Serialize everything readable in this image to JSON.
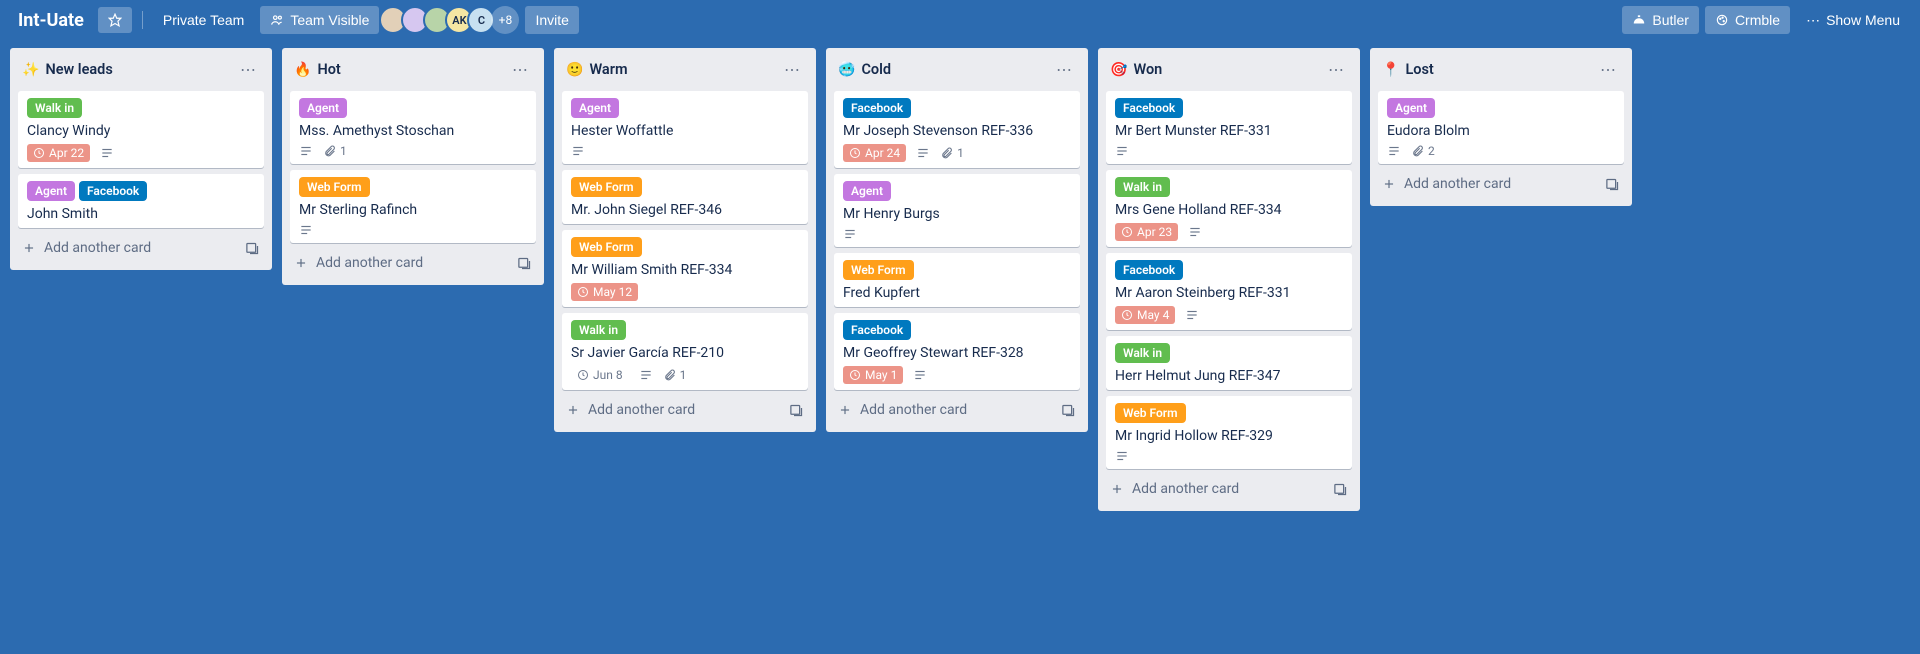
{
  "header": {
    "board_title": "Int-Uate",
    "private_team": "Private Team",
    "team_visible": "Team Visible",
    "plus_count": "+8",
    "invite": "Invite",
    "butler": "Butler",
    "crmble": "Crmble",
    "show_menu": "Show Menu",
    "avatar_labels": [
      "",
      "",
      "",
      "AK",
      "C"
    ]
  },
  "labels": {
    "walkin": "Walk in",
    "agent": "Agent",
    "facebook": "Facebook",
    "webform": "Web Form"
  },
  "add_card_text": "Add another card",
  "lists": [
    {
      "emoji": "✨",
      "title": "New leads",
      "cards": [
        {
          "labels": [
            "walkin"
          ],
          "title": "Clancy Windy",
          "due": "Apr 22",
          "due_style": "red",
          "desc": true
        },
        {
          "labels": [
            "agent",
            "facebook"
          ],
          "title": "John Smith"
        }
      ]
    },
    {
      "emoji": "🔥",
      "title": "Hot",
      "cards": [
        {
          "labels": [
            "agent"
          ],
          "title": "Mss. Amethyst Stoschan",
          "desc": true,
          "attach": "1"
        },
        {
          "labels": [
            "webform"
          ],
          "title": "Mr Sterling Rafinch",
          "desc": true
        }
      ]
    },
    {
      "emoji": "🙂",
      "title": "Warm",
      "cards": [
        {
          "labels": [
            "agent"
          ],
          "title": "Hester Woffattle",
          "desc": true
        },
        {
          "labels": [
            "webform"
          ],
          "title": "Mr. John Siegel REF-346"
        },
        {
          "labels": [
            "webform"
          ],
          "title": "Mr William Smith REF-334",
          "due": "May 12",
          "due_style": "red"
        },
        {
          "labels": [
            "walkin"
          ],
          "title": "Sr Javier García REF-210",
          "due": "Jun 8",
          "due_style": "plain",
          "desc": true,
          "attach": "1"
        }
      ]
    },
    {
      "emoji": "🥶",
      "title": "Cold",
      "cards": [
        {
          "labels": [
            "facebook"
          ],
          "title": "Mr Joseph Stevenson REF-336",
          "due": "Apr 24",
          "due_style": "red",
          "desc": true,
          "attach": "1"
        },
        {
          "labels": [
            "agent"
          ],
          "title": "Mr Henry Burgs",
          "desc": true
        },
        {
          "labels": [
            "webform"
          ],
          "title": "Fred Kupfert"
        },
        {
          "labels": [
            "facebook"
          ],
          "title": "Mr Geoffrey Stewart REF-328",
          "due": "May 1",
          "due_style": "red",
          "desc": true
        }
      ]
    },
    {
      "emoji": "🎯",
      "title": "Won",
      "cards": [
        {
          "labels": [
            "facebook"
          ],
          "title": "Mr Bert Munster REF-331",
          "desc": true
        },
        {
          "labels": [
            "walkin"
          ],
          "title": "Mrs Gene Holland REF-334",
          "due": "Apr 23",
          "due_style": "red",
          "desc": true
        },
        {
          "labels": [
            "facebook"
          ],
          "title": "Mr Aaron Steinberg REF-331",
          "due": "May 4",
          "due_style": "red",
          "desc": true
        },
        {
          "labels": [
            "walkin"
          ],
          "title": "Herr Helmut Jung REF-347"
        },
        {
          "labels": [
            "webform"
          ],
          "title": "Mr Ingrid Hollow REF-329",
          "desc": true
        }
      ]
    },
    {
      "emoji": "📍",
      "title": "Lost",
      "cards": [
        {
          "labels": [
            "agent"
          ],
          "title": "Eudora Blolm",
          "desc": true,
          "attach": "2"
        }
      ]
    }
  ]
}
